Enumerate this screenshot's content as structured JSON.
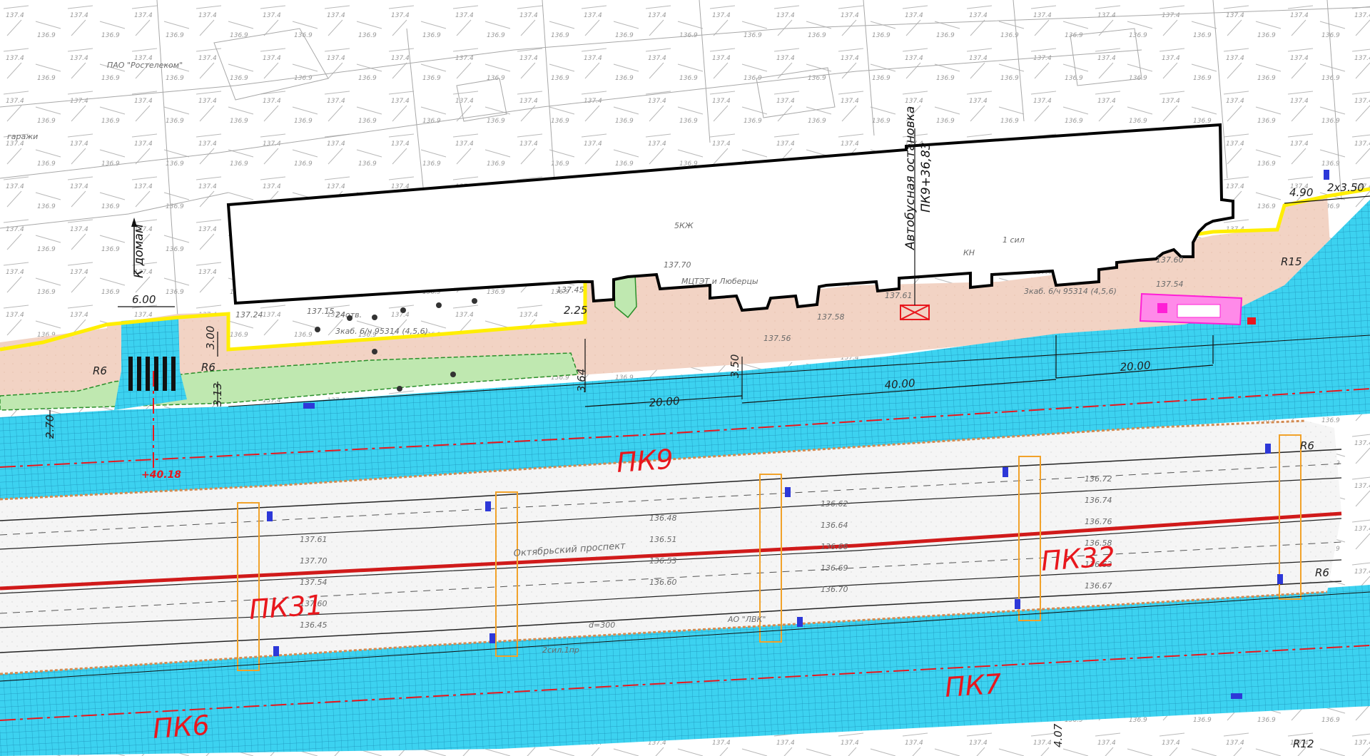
{
  "map": {
    "colors": {
      "roadway": "#3cd2f0",
      "roadway_grid": "#1a8fb8",
      "sidewalk": "#f2d3c4",
      "greenery": "#bfe8b0",
      "building_outline": "#000000",
      "yellow_curb": "#ffee00",
      "median": "#f4f4f4",
      "chainage_text": "#e8171d",
      "survey_text": "#8c8c8c",
      "magenta_pavilion": "#ff1fd6"
    },
    "chainage_labels": [
      "ПК9",
      "ПК31",
      "ПК32",
      "ПК7",
      "ПК6"
    ],
    "offset_label": "+40.18",
    "bus_stop": {
      "title": "Автобусная остановка",
      "chainage": "ПК9+36,83"
    },
    "direction_label": "К домам",
    "dimensions": [
      "6.00",
      "3.00",
      "3.13",
      "2.25",
      "3.64",
      "3.50",
      "20.00",
      "40.00",
      "20.00",
      "2.70",
      "4.90",
      "2x3.50",
      "R6",
      "R6",
      "R15",
      "R6",
      "R6",
      "R12",
      "4.07"
    ],
    "street_name": "Октябрьский проспект",
    "utility_labels": [
      "АО \"ЛВК\"",
      "ПАО \"Ростелеком\"",
      "МЦТЭТ и Люберцы",
      "3каб. 6/ч 95314 (4,5,6)",
      "d=300",
      "2сил.1пр",
      "1 сил",
      "гаражи",
      "КН",
      "5КЖ",
      "24отв."
    ],
    "elevations": [
      "137.15",
      "137.24",
      "137.45",
      "137.58",
      "137.56",
      "137.61",
      "137.70",
      "137.54",
      "137.60",
      "136.45",
      "136.48",
      "136.51",
      "136.53",
      "136.60",
      "136.62",
      "136.64",
      "136.66",
      "136.69",
      "136.70",
      "136.72",
      "136.74",
      "136.76",
      "136.58",
      "136.63",
      "136.67"
    ]
  }
}
